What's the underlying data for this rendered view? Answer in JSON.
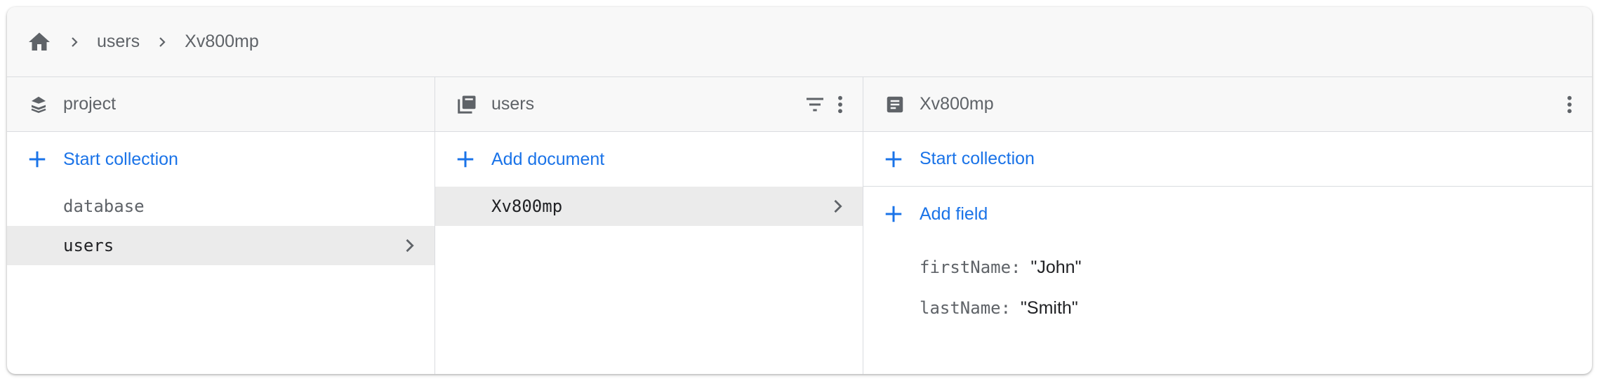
{
  "breadcrumb": {
    "items": [
      "users",
      "Xv800mp"
    ]
  },
  "columns": {
    "root": {
      "title": "project",
      "action_label": "Start collection",
      "items": [
        "database",
        "users"
      ]
    },
    "collection": {
      "title": "users",
      "action_label": "Add document",
      "items": [
        "Xv800mp"
      ]
    },
    "document": {
      "title": "Xv800mp",
      "start_collection_label": "Start collection",
      "add_field_label": "Add field",
      "fields": [
        {
          "key": "firstName",
          "value": "\"John\""
        },
        {
          "key": "lastName",
          "value": "\"Smith\""
        }
      ]
    }
  },
  "colors": {
    "accent": "#1a73e8",
    "icon": "#5f6368",
    "selected_bg": "#ebebeb"
  }
}
